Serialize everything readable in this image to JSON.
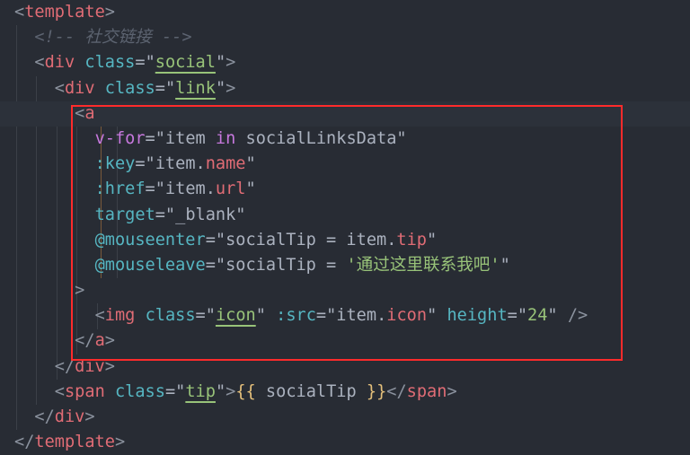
{
  "editor": {
    "current_line": 4,
    "lines": [
      [
        [
          "<",
          "p"
        ],
        [
          "template",
          "tag"
        ],
        [
          ">",
          "p"
        ]
      ],
      [
        [
          "  "
        ],
        [
          "<!-- ",
          "cm"
        ],
        [
          "社交链接",
          "cm"
        ],
        [
          " -->",
          "cm"
        ]
      ],
      [
        [
          "  "
        ],
        [
          "<",
          "p"
        ],
        [
          "div",
          "tag"
        ],
        [
          " "
        ],
        [
          "class",
          "attr"
        ],
        [
          "=\"",
          "tx"
        ],
        [
          "social",
          "str u"
        ],
        [
          "\"",
          "tx"
        ],
        [
          ">",
          "p"
        ]
      ],
      [
        [
          "    "
        ],
        [
          "<",
          "p"
        ],
        [
          "div",
          "tag"
        ],
        [
          " "
        ],
        [
          "class",
          "attr"
        ],
        [
          "=\"",
          "tx"
        ],
        [
          "link",
          "str u"
        ],
        [
          "\"",
          "tx"
        ],
        [
          ">",
          "p"
        ]
      ],
      [
        [
          "      "
        ],
        [
          "<",
          "p"
        ],
        [
          "a",
          "tag"
        ]
      ],
      [
        [
          "        "
        ],
        [
          "v-for",
          "kw"
        ],
        [
          "=\"item ",
          "tx"
        ],
        [
          "in",
          "kw"
        ],
        [
          " socialLinksData\"",
          "tx"
        ]
      ],
      [
        [
          "        "
        ],
        [
          ":key",
          "attr"
        ],
        [
          "=\"item.",
          "tx"
        ],
        [
          "name",
          "tag"
        ],
        [
          "\"",
          "tx"
        ]
      ],
      [
        [
          "        "
        ],
        [
          ":href",
          "attr"
        ],
        [
          "=\"item.",
          "tx"
        ],
        [
          "url",
          "tag"
        ],
        [
          "\"",
          "tx"
        ]
      ],
      [
        [
          "        "
        ],
        [
          "target",
          "attr"
        ],
        [
          "=\"_blank\"",
          "tx"
        ]
      ],
      [
        [
          "        "
        ],
        [
          "@mouseenter",
          "attr"
        ],
        [
          "=\"socialTip = item.",
          "tx"
        ],
        [
          "tip",
          "tag"
        ],
        [
          "\"",
          "tx"
        ]
      ],
      [
        [
          "        "
        ],
        [
          "@mouseleave",
          "attr"
        ],
        [
          "=\"socialTip = ",
          "tx"
        ],
        [
          "'通过这里联系我吧'",
          "str"
        ],
        [
          "\"",
          "tx"
        ]
      ],
      [
        [
          "      "
        ],
        [
          ">",
          "p"
        ]
      ],
      [
        [
          "        "
        ],
        [
          "<",
          "p"
        ],
        [
          "img",
          "tag"
        ],
        [
          " "
        ],
        [
          "class",
          "attr"
        ],
        [
          "=\"",
          "tx"
        ],
        [
          "icon",
          "str u"
        ],
        [
          "\"",
          "tx"
        ],
        [
          " "
        ],
        [
          ":src",
          "attr"
        ],
        [
          "=\"item.",
          "tx"
        ],
        [
          "icon",
          "tag"
        ],
        [
          "\"",
          "tx"
        ],
        [
          " "
        ],
        [
          "height",
          "attr"
        ],
        [
          "=\"",
          "tx"
        ],
        [
          "24",
          "str"
        ],
        [
          "\"",
          "tx"
        ],
        [
          " />",
          "p"
        ]
      ],
      [
        [
          "      "
        ],
        [
          "</",
          "p"
        ],
        [
          "a",
          "tag"
        ],
        [
          ">",
          "p"
        ]
      ],
      [
        [
          "    "
        ],
        [
          "</",
          "p"
        ],
        [
          "div",
          "tag"
        ],
        [
          ">",
          "p"
        ]
      ],
      [
        [
          "    "
        ],
        [
          "<",
          "p"
        ],
        [
          "span",
          "tag"
        ],
        [
          " "
        ],
        [
          "class",
          "attr"
        ],
        [
          "=\"",
          "tx"
        ],
        [
          "tip",
          "str u"
        ],
        [
          "\"",
          "tx"
        ],
        [
          ">",
          "p"
        ],
        [
          "{{",
          "br"
        ],
        [
          " socialTip ",
          "tx"
        ],
        [
          "}}",
          "br"
        ],
        [
          "</",
          "p"
        ],
        [
          "span",
          "tag"
        ],
        [
          ">",
          "p"
        ]
      ],
      [
        [
          "  "
        ],
        [
          "</",
          "p"
        ],
        [
          "div",
          "tag"
        ],
        [
          ">",
          "p"
        ]
      ],
      [
        [
          "</",
          "p"
        ],
        [
          "template",
          "tag"
        ],
        [
          ">",
          "p"
        ]
      ]
    ]
  }
}
